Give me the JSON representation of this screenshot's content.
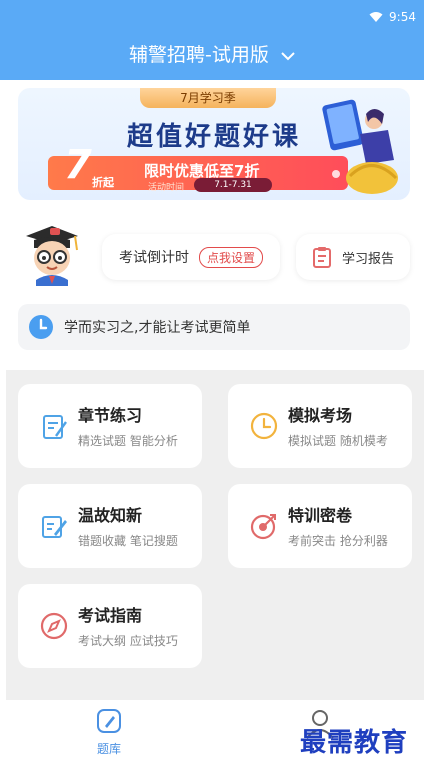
{
  "status": {
    "time": "9:54"
  },
  "header": {
    "title": "辅警招聘-试用版"
  },
  "banner": {
    "tag": "7月学习季",
    "headline": "超值好题好课",
    "number": "7",
    "number_unit": "折起",
    "offer": "限时优惠低至7折",
    "time_label": "活动时间",
    "time_range": "7.1-7.31"
  },
  "chips": {
    "countdown_label": "考试倒计时",
    "countdown_button": "点我设置",
    "report_label": "学习报告"
  },
  "tip": {
    "text": "学而实习之,才能让考试更简单"
  },
  "cards": [
    {
      "title": "章节练习",
      "subtitle": "精选试题 智能分析"
    },
    {
      "title": "模拟考场",
      "subtitle": "模拟试题 随机模考"
    },
    {
      "title": "温故知新",
      "subtitle": "错题收藏 笔记搜题"
    },
    {
      "title": "特训密卷",
      "subtitle": "考前突击 抢分利器"
    },
    {
      "title": "考试指南",
      "subtitle": "考试大纲 应试技巧"
    }
  ],
  "tabbar": {
    "tiku_label": "题库"
  },
  "watermark": {
    "text": "最需教育"
  },
  "colors": {
    "primary": "#5aaaf6",
    "accent_red": "#e24b4b",
    "tab_active": "#4a90e2"
  }
}
